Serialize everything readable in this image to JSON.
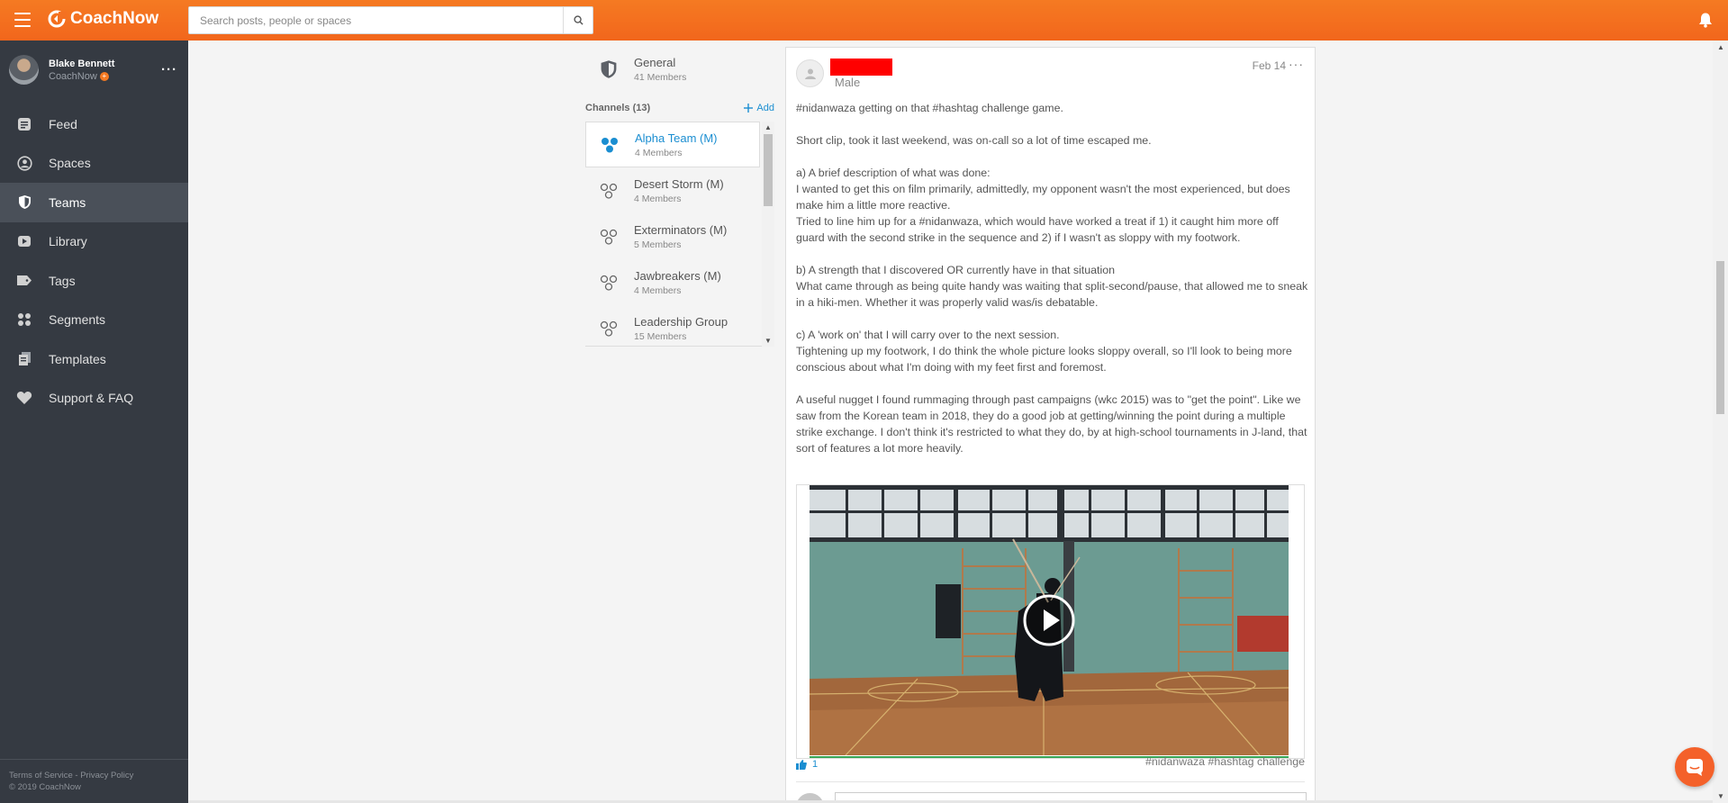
{
  "app": {
    "brand": "CoachNow",
    "accent": "#f2661c"
  },
  "search": {
    "placeholder": "Search posts, people or spaces"
  },
  "user": {
    "name": "Blake Bennett",
    "subtitle": "CoachNow",
    "badge": "+"
  },
  "sidebar": {
    "items": [
      {
        "label": "Feed",
        "icon": "feed-icon"
      },
      {
        "label": "Spaces",
        "icon": "spaces-icon"
      },
      {
        "label": "Teams",
        "icon": "shield-icon",
        "active": true
      },
      {
        "label": "Library",
        "icon": "library-icon"
      },
      {
        "label": "Tags",
        "icon": "tag-icon"
      },
      {
        "label": "Segments",
        "icon": "segments-icon"
      },
      {
        "label": "Templates",
        "icon": "templates-icon"
      },
      {
        "label": "Support & FAQ",
        "icon": "heart-icon"
      }
    ],
    "footer": {
      "terms": "Terms of Service",
      "sep": "-",
      "privacy": "Privacy Policy",
      "copyright": "© 2019 CoachNow"
    }
  },
  "team": {
    "general": {
      "name": "General",
      "members": "41 Members"
    },
    "channels_label": "Channels (13)",
    "add_label": "Add",
    "channels": [
      {
        "name": "Alpha Team (M)",
        "members": "4 Members"
      },
      {
        "name": "Desert Storm (M)",
        "members": "4 Members"
      },
      {
        "name": "Exterminators (M)",
        "members": "5 Members"
      },
      {
        "name": "Jawbreakers (M)",
        "members": "4 Members"
      },
      {
        "name": "Leadership Group",
        "members": "15 Members"
      }
    ]
  },
  "post": {
    "author_subtitle": "Male",
    "date": "Feb 14",
    "more": "···",
    "paragraphs": [
      [
        "#nidanwaza getting on that #hashtag challenge game."
      ],
      [
        "Short clip, took it last weekend, was on-call so a lot of time escaped me."
      ],
      [
        "a) A brief description of what was done:",
        "I wanted to get this on film primarily, admittedly, my opponent wasn't the most experienced, but does make him a little more reactive.",
        "Tried to line him up for a #nidanwaza, which would have worked a treat if 1) it caught him more off guard with the second strike in the sequence and 2) if I wasn't as sloppy with my footwork."
      ],
      [
        "b) A strength that I discovered OR currently have in that situation",
        "What came through as being quite handy was waiting that split-second/pause, that allowed me to sneak in a hiki-men. Whether it was properly valid was/is debatable."
      ],
      [
        "c) A 'work on' that I will carry over to the next session.",
        "Tightening up my footwork, I do think the whole picture looks sloppy overall, so I'll look to being more conscious about what I'm doing with my feet first and foremost."
      ],
      [
        "A useful nugget I found rummaging through past campaigns (wkc 2015) was to \"get the point\". Like we saw from the Korean team in 2018, they do a good job at getting/winning the point during a multiple strike exchange. I don't think it's restricted to what they do, by at high-school tournaments in J-land, that sort of features a lot more heavily."
      ]
    ],
    "reactions": "1",
    "tags": "#nidanwaza #hashtag challenge"
  }
}
